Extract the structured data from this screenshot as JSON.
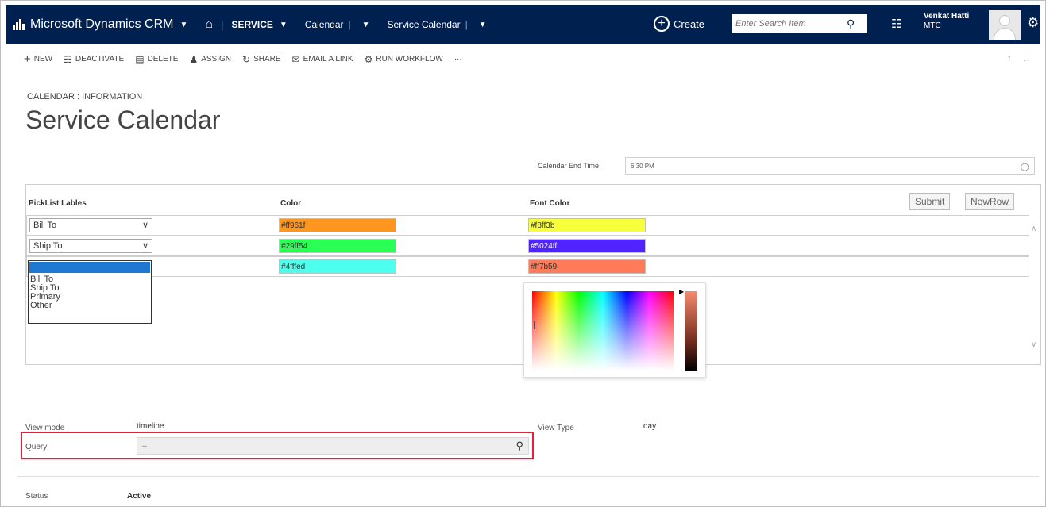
{
  "nav": {
    "brand": "Microsoft Dynamics CRM",
    "section": "SERVICE",
    "entity": "Calendar",
    "record": "Service Calendar",
    "create": "Create",
    "search_placeholder": "Enter Search Item",
    "user_name": "Venkat Hatti",
    "user_org": "MTC"
  },
  "commands": [
    {
      "label": "NEW",
      "icon": "plus-icon"
    },
    {
      "label": "DEACTIVATE",
      "icon": "deactivate-icon"
    },
    {
      "label": "DELETE",
      "icon": "trash-icon"
    },
    {
      "label": "ASSIGN",
      "icon": "assign-icon"
    },
    {
      "label": "SHARE",
      "icon": "share-icon"
    },
    {
      "label": "EMAIL A LINK",
      "icon": "email-icon"
    },
    {
      "label": "RUN WORKFLOW",
      "icon": "workflow-icon"
    },
    {
      "label": "···",
      "icon": "more-icon"
    }
  ],
  "breadcrumb": "CALENDAR : INFORMATION",
  "title": "Service Calendar",
  "end_time": {
    "label": "Calendar End Time",
    "value": "6:30 PM"
  },
  "grid": {
    "headers": {
      "picklist": "PickList Lables",
      "color": "Color",
      "font_color": "Font Color"
    },
    "buttons": {
      "submit": "Submit",
      "newrow": "NewRow"
    },
    "rows": [
      {
        "label": "Bill To",
        "color": "#ff961f",
        "font_color": "#f8ff3b",
        "color_bg": "#ff961f",
        "font_bg": "#f8ff3b"
      },
      {
        "label": "Ship To",
        "color": "#29ff54",
        "font_color": "#5024ff",
        "color_bg": "#29ff54",
        "font_bg": "#5024ff"
      },
      {
        "label": "",
        "color": "#4fffed",
        "font_color": "#ff7b59",
        "color_bg": "#4fffed",
        "font_bg": "#ff7b59"
      }
    ],
    "dropdown_options": [
      "Bill To",
      "Ship To",
      "Primary",
      "Other"
    ]
  },
  "form": {
    "view_mode_label": "View mode",
    "view_mode_value": "timeline",
    "view_type_label": "View Type",
    "view_type_value": "day",
    "query_label": "Query",
    "query_value": "--",
    "status_label": "Status",
    "status_value": "Active"
  },
  "colors": {
    "navbar": "#002050",
    "highlight": "#e0203c",
    "selected": "#1e78d2"
  }
}
